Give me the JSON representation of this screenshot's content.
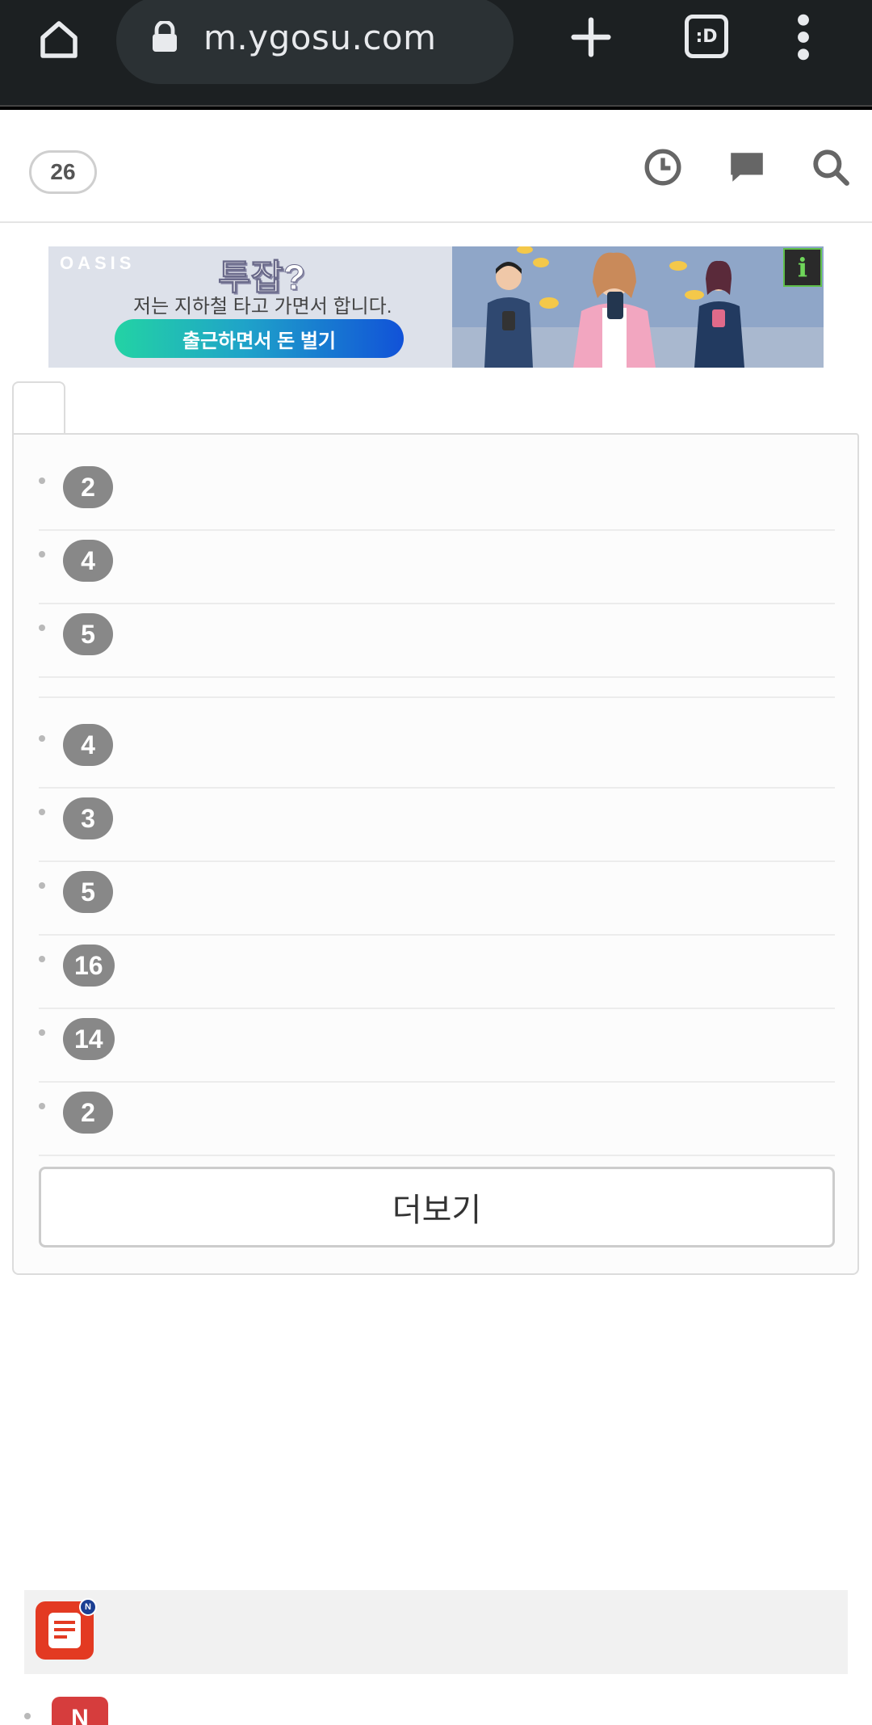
{
  "browser": {
    "url": "m.ygosu.com",
    "tabs_label": ":D"
  },
  "header": {
    "count": "26",
    "icons": [
      "clock-icon",
      "chat-icon",
      "search-icon"
    ]
  },
  "ad": {
    "brand": "OASIS",
    "title": "투잡?",
    "subtitle": "저는 지하철 타고 가면서 합니다.",
    "cta": "출근하면서 돈 벌기",
    "info": "i"
  },
  "list": {
    "rows": [
      {
        "badge": "2"
      },
      {
        "badge": "4"
      },
      {
        "badge": "5"
      },
      {
        "badge": "4"
      },
      {
        "badge": "3"
      },
      {
        "badge": "5"
      },
      {
        "badge": "16"
      },
      {
        "badge": "14"
      },
      {
        "badge": "2"
      }
    ],
    "more_label": "더보기"
  },
  "bottom": {
    "news_badge": "N",
    "n_label": "N"
  },
  "colors": {
    "chrome": "#1c2022",
    "badge": "#888888",
    "news": "#e33a22"
  }
}
